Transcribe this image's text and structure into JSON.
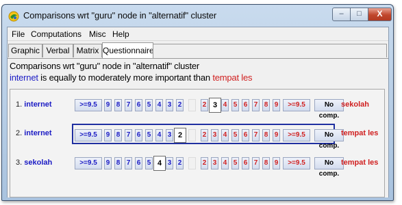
{
  "window": {
    "title": "Comparisons wrt \"guru\" node in \"alternatif\" cluster",
    "buttons": {
      "minimize": "–",
      "maximize": "□",
      "close": "X"
    }
  },
  "menu": [
    "File",
    "Computations",
    "Misc",
    "Help"
  ],
  "tabs": [
    {
      "label": "Graphic",
      "active": false
    },
    {
      "label": "Verbal",
      "active": false
    },
    {
      "label": "Matrix",
      "active": false
    },
    {
      "label": "Questionnaire",
      "active": true
    }
  ],
  "panel": {
    "heading": "Comparisons wrt \"guru\" node in \"alternatif\" cluster",
    "summary": {
      "left": "internet",
      "middle": " is equally to moderately more important than ",
      "right": "tempat les"
    }
  },
  "scale": {
    "left_labels": [
      ">=9.5",
      "9",
      "8",
      "7",
      "6",
      "5",
      "4",
      "3",
      "2"
    ],
    "right_labels": [
      "2",
      "3",
      "4",
      "5",
      "6",
      "7",
      "8",
      "9",
      ">=9.5"
    ],
    "no_comp": "No comp."
  },
  "rows": [
    {
      "num": "1.",
      "left": "internet",
      "right": "sekolah",
      "selected": false,
      "value": "right-3"
    },
    {
      "num": "2.",
      "left": "internet",
      "right": "tempat les",
      "selected": true,
      "value": "left-2"
    },
    {
      "num": "3.",
      "left": "sekolah",
      "right": "tempat les",
      "selected": false,
      "value": "left-4"
    }
  ],
  "colors": {
    "left_item": "#1b1bc4",
    "right_item": "#d02020",
    "selected_row_border": "#1f2fa0",
    "title_bar": "#c9dbee"
  }
}
